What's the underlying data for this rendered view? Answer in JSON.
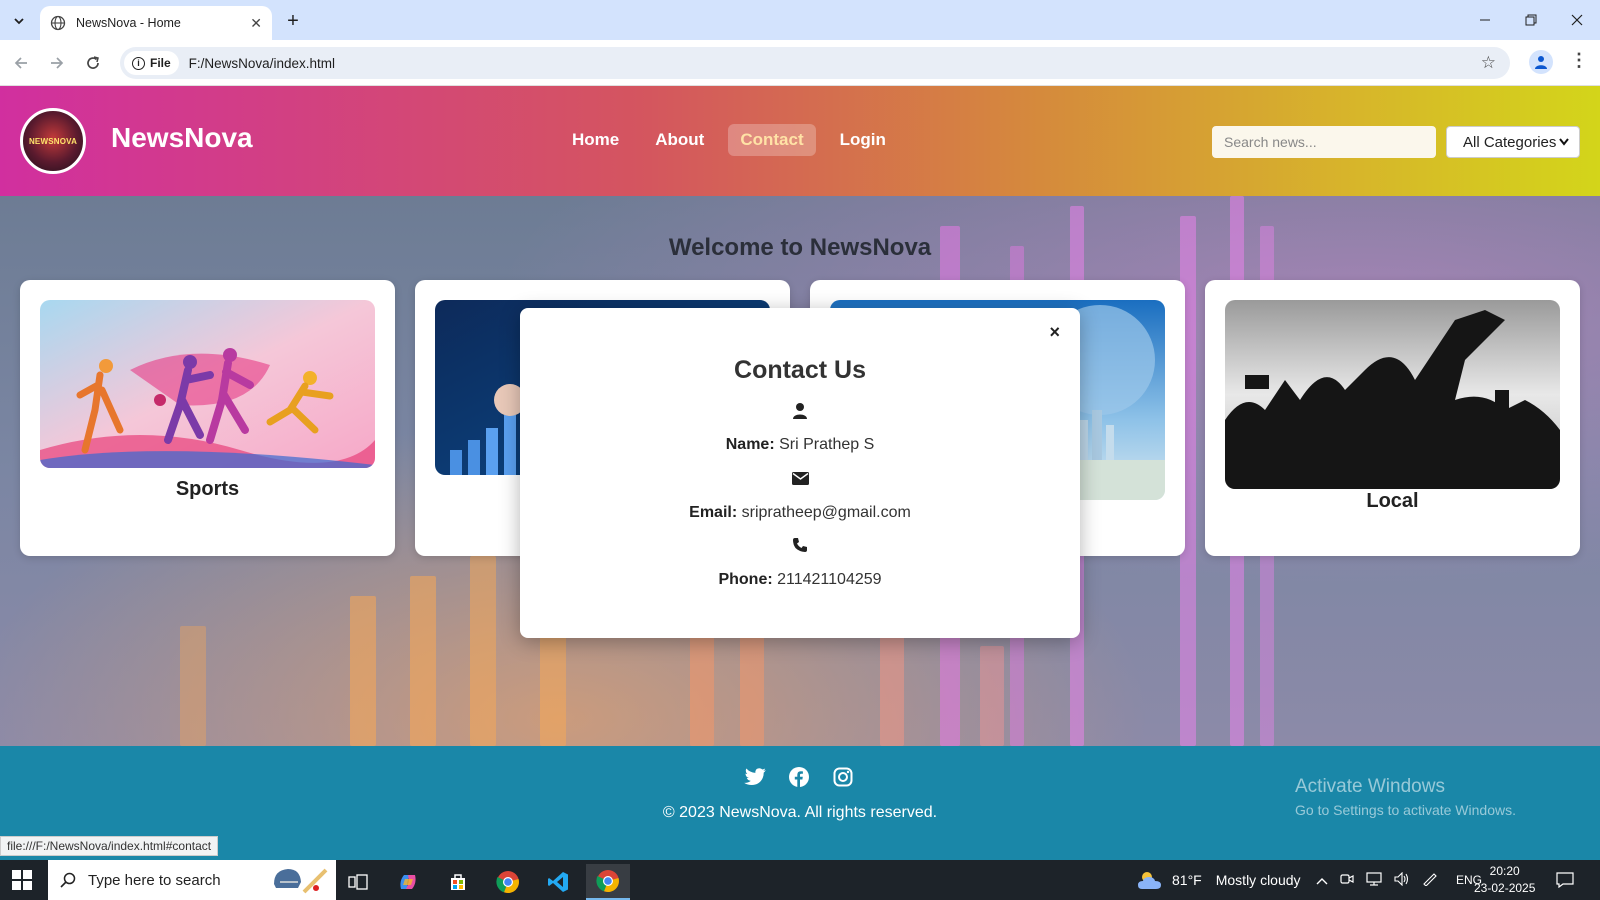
{
  "browser": {
    "tab_title": "NewsNova - Home",
    "url_chip": "File",
    "url": "F:/NewsNova/index.html",
    "status_url": "file:///F:/NewsNova/index.html#contact"
  },
  "header": {
    "logo_text": "NEWSNOVA",
    "brand": "NewsNova",
    "nav": [
      {
        "label": "Home"
      },
      {
        "label": "About"
      },
      {
        "label": "Contact",
        "active": true
      },
      {
        "label": "Login"
      }
    ],
    "search_placeholder": "Search news...",
    "category_selected": "All Categories"
  },
  "main": {
    "welcome": "Welcome to NewsNova",
    "cards": [
      {
        "title": "Sports"
      },
      {
        "title": ""
      },
      {
        "title": ""
      },
      {
        "title": "Local"
      }
    ]
  },
  "contact_modal": {
    "title": "Contact Us",
    "close": "×",
    "name_label": "Name:",
    "name_value": "Sri Prathep S",
    "email_label": "Email:",
    "email_value": "sripratheep@gmail.com",
    "phone_label": "Phone:",
    "phone_value": "211421104259"
  },
  "footer": {
    "social_icons": [
      "twitter-icon",
      "facebook-icon",
      "instagram-icon"
    ],
    "copyright": "© 2023 NewsNova. All rights reserved.",
    "watermark_line1": "Activate Windows",
    "watermark_line2": "Go to Settings to activate Windows."
  },
  "taskbar": {
    "search_placeholder": "Type here to search",
    "weather_temp": "81°F",
    "weather_text": "Mostly cloudy",
    "language": "ENG",
    "time": "20:20",
    "date": "23-02-2025"
  },
  "colors": {
    "header_gradient_start": "#d12f9f",
    "header_gradient_end": "#d3d51a",
    "footer": "#1a87a8",
    "taskbar": "#1d2329"
  }
}
